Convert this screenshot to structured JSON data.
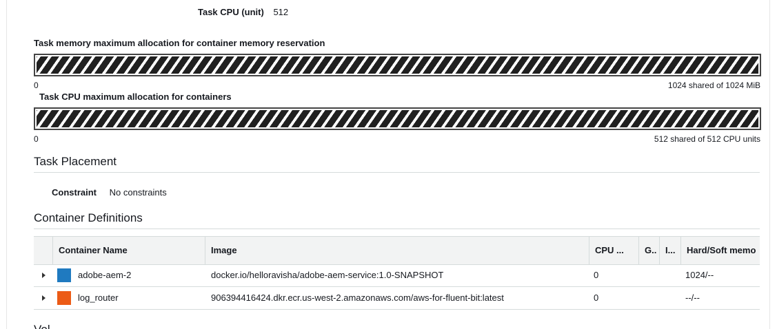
{
  "task": {
    "cpu_label": "Task CPU (unit)",
    "cpu_value": "512"
  },
  "memory_bar": {
    "title": "Task memory maximum allocation for container memory reservation",
    "min": "0",
    "max": "1024 shared of 1024 MiB",
    "fill_fraction": 1.0
  },
  "cpu_bar": {
    "title": "Task CPU maximum allocation for containers",
    "min": "0",
    "max": "512 shared of 512 CPU units",
    "fill_fraction": 1.0
  },
  "placement": {
    "title": "Task Placement",
    "constraint_label": "Constraint",
    "constraint_value": "No constraints"
  },
  "containers": {
    "title": "Container Definitions",
    "columns": [
      "Container Name",
      "Image",
      "CPU ...",
      "G..",
      "I...",
      "Hard/Soft memo"
    ],
    "rows": [
      {
        "name": "adobe-aem-2",
        "color": "#1f7ac0",
        "image": "docker.io/helloravisha/adobe-aem-service:1.0-SNAPSHOT",
        "cpu": "0",
        "memory": "1024/--"
      },
      {
        "name": "log_router",
        "color": "#ec5b16",
        "image": "906394416424.dkr.ecr.us-west-2.amazonaws.com/aws-for-fluent-bit:latest",
        "cpu": "0",
        "memory": "--/--"
      }
    ]
  },
  "next_section_partial": "Vol"
}
